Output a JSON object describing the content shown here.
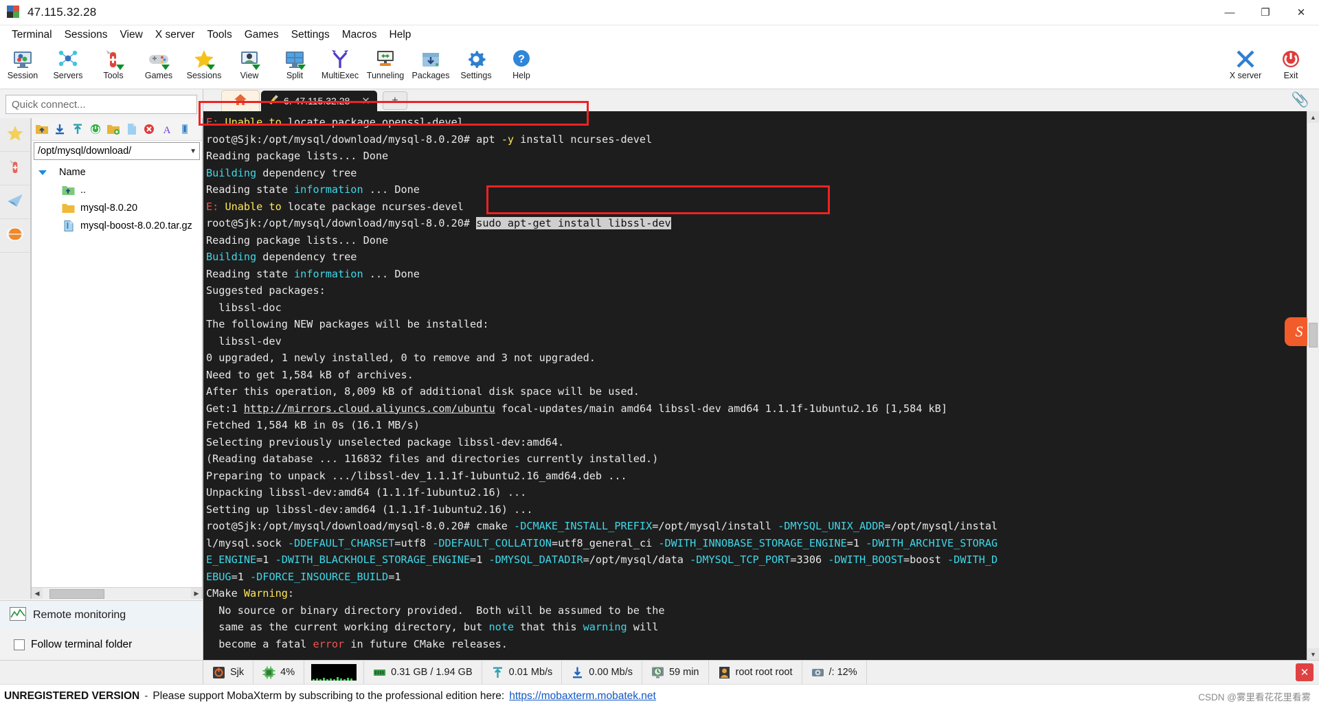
{
  "window": {
    "title": "47.115.32.28",
    "minimize": "—",
    "maximize": "❐",
    "close": "✕"
  },
  "menubar": {
    "items": [
      "Terminal",
      "Sessions",
      "View",
      "X server",
      "Tools",
      "Games",
      "Settings",
      "Macros",
      "Help"
    ]
  },
  "toolbar": {
    "buttons": [
      {
        "label": "Session",
        "icon": "session-icon"
      },
      {
        "label": "Servers",
        "icon": "servers-icon"
      },
      {
        "label": "Tools",
        "icon": "tools-icon"
      },
      {
        "label": "Games",
        "icon": "games-icon"
      },
      {
        "label": "Sessions",
        "icon": "sessions-star-icon"
      },
      {
        "label": "View",
        "icon": "view-icon"
      },
      {
        "label": "Split",
        "icon": "split-icon"
      },
      {
        "label": "MultiExec",
        "icon": "multiexec-icon"
      },
      {
        "label": "Tunneling",
        "icon": "tunneling-icon"
      },
      {
        "label": "Packages",
        "icon": "packages-icon"
      },
      {
        "label": "Settings",
        "icon": "settings-gear-icon"
      },
      {
        "label": "Help",
        "icon": "help-icon"
      }
    ],
    "right": [
      {
        "label": "X server",
        "icon": "xserver-icon"
      },
      {
        "label": "Exit",
        "icon": "exit-power-icon"
      }
    ]
  },
  "sidebar": {
    "quick_connect_placeholder": "Quick connect...",
    "vtabs": [
      {
        "name": "favorites-tab",
        "icon": "star-icon"
      },
      {
        "name": "tools-tab",
        "icon": "swiss-knife-icon"
      },
      {
        "name": "sessions-tab",
        "icon": "paper-plane-icon"
      },
      {
        "name": "macros-tab",
        "icon": "globe-icon"
      }
    ],
    "sftp_tools": [
      {
        "name": "parent-folder-button",
        "icon": "folder-up-icon"
      },
      {
        "name": "download-button",
        "icon": "download-arrow-icon"
      },
      {
        "name": "upload-button",
        "icon": "upload-arrow-icon"
      },
      {
        "name": "refresh-button",
        "icon": "refresh-circle-icon"
      },
      {
        "name": "new-folder-button",
        "icon": "new-folder-icon"
      },
      {
        "name": "new-file-button",
        "icon": "new-file-icon"
      },
      {
        "name": "delete-button",
        "icon": "delete-x-icon"
      },
      {
        "name": "text-mode-button",
        "icon": "letter-a-icon"
      },
      {
        "name": "binary-mode-button",
        "icon": "usb-drive-icon"
      }
    ],
    "path": "/opt/mysql/download/",
    "column_header": "Name",
    "files": [
      {
        "name": "..",
        "type": "parent-folder"
      },
      {
        "name": "mysql-8.0.20",
        "type": "folder"
      },
      {
        "name": "mysql-boost-8.0.20.tar.gz",
        "type": "file"
      }
    ],
    "remote_monitoring_label": "Remote monitoring",
    "follow_terminal_folder_label": "Follow terminal folder",
    "follow_checked": false
  },
  "tabs": {
    "home_icon": "home-icon",
    "terminal_tab": "6. 47.115.32.28",
    "terminal_tab_close": "✕",
    "new_tab": "+",
    "clip_icon": "paperclip-icon"
  },
  "terminal": {
    "lines": [
      [
        {
          "t": "E:",
          "c": "red"
        },
        {
          "t": " ",
          "c": "wht"
        },
        {
          "t": "Unable to",
          "c": "yel"
        },
        {
          "t": " locate package openssl-devel",
          "c": "wht"
        }
      ],
      [
        {
          "t": "root@Sjk:/opt/mysql/download/mysql-8.0.20# apt ",
          "c": "wht"
        },
        {
          "t": "-y",
          "c": "yel"
        },
        {
          "t": " install ncurses-devel",
          "c": "wht"
        }
      ],
      [
        {
          "t": "Reading package lists... Done",
          "c": "wht"
        }
      ],
      [
        {
          "t": "Building",
          "c": "cyan"
        },
        {
          "t": " dependency tree",
          "c": "wht"
        }
      ],
      [
        {
          "t": "Reading state ",
          "c": "wht"
        },
        {
          "t": "information",
          "c": "cyan"
        },
        {
          "t": " ... Done",
          "c": "wht"
        }
      ],
      [
        {
          "t": "E:",
          "c": "red"
        },
        {
          "t": " ",
          "c": "wht"
        },
        {
          "t": "Unable to",
          "c": "yel"
        },
        {
          "t": " locate package ncurses-devel",
          "c": "wht"
        }
      ],
      [
        {
          "t": "root@Sjk:/opt/mysql/download/mysql-8.0.20# ",
          "c": "wht"
        },
        {
          "t": "sudo apt-get install libssl-dev",
          "c": "sel"
        }
      ],
      [
        {
          "t": "Reading package lists... Done",
          "c": "wht"
        }
      ],
      [
        {
          "t": "Building",
          "c": "cyan"
        },
        {
          "t": " dependency tree",
          "c": "wht"
        }
      ],
      [
        {
          "t": "Reading state ",
          "c": "wht"
        },
        {
          "t": "information",
          "c": "cyan"
        },
        {
          "t": " ... Done",
          "c": "wht"
        }
      ],
      [
        {
          "t": "Suggested packages:",
          "c": "wht"
        }
      ],
      [
        {
          "t": "  libssl-doc",
          "c": "wht"
        }
      ],
      [
        {
          "t": "The following NEW packages will be installed:",
          "c": "wht"
        }
      ],
      [
        {
          "t": "  libssl-dev",
          "c": "wht"
        }
      ],
      [
        {
          "t": "0 upgraded, 1 newly installed, 0 to remove and 3 not upgraded.",
          "c": "wht"
        }
      ],
      [
        {
          "t": "Need to get 1,584 kB of archives.",
          "c": "wht"
        }
      ],
      [
        {
          "t": "After this operation, 8,009 kB of additional disk space will be used.",
          "c": "wht"
        }
      ],
      [
        {
          "t": "Get:1 ",
          "c": "wht"
        },
        {
          "t": "http://mirrors.cloud.aliyuncs.com/ubuntu",
          "c": "ul"
        },
        {
          "t": " focal-updates/main amd64 libssl-dev amd64 1.1.1f-1ubuntu2.16 [1,584 kB]",
          "c": "wht"
        }
      ],
      [
        {
          "t": "Fetched 1,584 kB in 0s (16.1 MB/s)",
          "c": "wht"
        }
      ],
      [
        {
          "t": "Selecting previously unselected package libssl-dev:amd64.",
          "c": "wht"
        }
      ],
      [
        {
          "t": "(Reading database ... 116832 files and directories currently installed.)",
          "c": "wht"
        }
      ],
      [
        {
          "t": "Preparing to unpack .../libssl-dev_1.1.1f-1ubuntu2.16_amd64.deb ...",
          "c": "wht"
        }
      ],
      [
        {
          "t": "Unpacking libssl-dev:amd64 (1.1.1f-1ubuntu2.16) ...",
          "c": "wht"
        }
      ],
      [
        {
          "t": "Setting up libssl-dev:amd64 (1.1.1f-1ubuntu2.16) ...",
          "c": "wht"
        }
      ],
      [
        {
          "t": "root@Sjk:/opt/mysql/download/mysql-8.0.20# cmake ",
          "c": "wht"
        },
        {
          "t": "-DCMAKE_INSTALL_PREFIX",
          "c": "cyan"
        },
        {
          "t": "=/opt/mysql/install ",
          "c": "wht"
        },
        {
          "t": "-DMYSQL_UNIX_ADDR",
          "c": "cyan"
        },
        {
          "t": "=/opt/mysql/instal",
          "c": "wht"
        }
      ],
      [
        {
          "t": "l/mysql.sock ",
          "c": "wht"
        },
        {
          "t": "-DDEFAULT_CHARSET",
          "c": "cyan"
        },
        {
          "t": "=utf8 ",
          "c": "wht"
        },
        {
          "t": "-DDEFAULT_COLLATION",
          "c": "cyan"
        },
        {
          "t": "=utf8_general_ci ",
          "c": "wht"
        },
        {
          "t": "-DWITH_INNOBASE_STORAGE_ENGINE",
          "c": "cyan"
        },
        {
          "t": "=1 ",
          "c": "wht"
        },
        {
          "t": "-DWITH_ARCHIVE_STORAG",
          "c": "cyan"
        }
      ],
      [
        {
          "t": "E_ENGINE",
          "c": "cyan"
        },
        {
          "t": "=1 ",
          "c": "wht"
        },
        {
          "t": "-DWITH_BLACKHOLE_STORAGE_ENGINE",
          "c": "cyan"
        },
        {
          "t": "=1 ",
          "c": "wht"
        },
        {
          "t": "-DMYSQL_DATADIR",
          "c": "cyan"
        },
        {
          "t": "=/opt/mysql/data ",
          "c": "wht"
        },
        {
          "t": "-DMYSQL_TCP_PORT",
          "c": "cyan"
        },
        {
          "t": "=3306 ",
          "c": "wht"
        },
        {
          "t": "-DWITH_BOOST",
          "c": "cyan"
        },
        {
          "t": "=boost ",
          "c": "wht"
        },
        {
          "t": "-DWITH_D",
          "c": "cyan"
        }
      ],
      [
        {
          "t": "EBUG",
          "c": "cyan"
        },
        {
          "t": "=1 ",
          "c": "wht"
        },
        {
          "t": "-DFORCE_INSOURCE_BUILD",
          "c": "cyan"
        },
        {
          "t": "=1",
          "c": "wht"
        }
      ],
      [
        {
          "t": "CMake ",
          "c": "wht"
        },
        {
          "t": "Warning",
          "c": "yel"
        },
        {
          "t": ":",
          "c": "wht"
        }
      ],
      [
        {
          "t": "  No source or binary directory provided.  Both will be assumed to be the",
          "c": "wht"
        }
      ],
      [
        {
          "t": "  same as the current working directory, but ",
          "c": "wht"
        },
        {
          "t": "note",
          "c": "cyan"
        },
        {
          "t": " that this ",
          "c": "wht"
        },
        {
          "t": "warning",
          "c": "cyan"
        },
        {
          "t": " will",
          "c": "wht"
        }
      ],
      [
        {
          "t": "  become a fatal ",
          "c": "wht"
        },
        {
          "t": "error",
          "c": "red"
        },
        {
          "t": " in future CMake releases.",
          "c": "wht"
        }
      ]
    ],
    "annotations": [
      {
        "name": "highlight-openssl-error"
      },
      {
        "name": "highlight-libssl-command"
      }
    ]
  },
  "statusbar": {
    "cells": [
      {
        "name": "hostname",
        "icon": "server-icon",
        "text": "Sjk"
      },
      {
        "name": "cpu-usage",
        "icon": "cpu-icon",
        "text": "4%"
      },
      {
        "name": "cpu-graph",
        "icon": "graph-icon",
        "text": ""
      },
      {
        "name": "memory",
        "icon": "memory-icon",
        "text": "0.31 GB / 1.94 GB"
      },
      {
        "name": "upload-speed",
        "icon": "upload-icon",
        "text": "0.01 Mb/s"
      },
      {
        "name": "download-speed",
        "icon": "download-icon",
        "text": "0.00 Mb/s"
      },
      {
        "name": "uptime",
        "icon": "clock-icon",
        "text": "59 min"
      },
      {
        "name": "users",
        "icon": "user-icon",
        "text": "root  root  root"
      },
      {
        "name": "disk-usage",
        "icon": "disk-icon",
        "text": "/: 12%"
      }
    ],
    "close_label": "✕"
  },
  "footer": {
    "unregistered": "UNREGISTERED VERSION",
    "dash": "-",
    "message": "Please support MobaXterm by subscribing to the professional edition here:",
    "link": "https://mobaxterm.mobatek.net",
    "watermark": "CSDN @雾里看花花里看雾"
  },
  "colors": {
    "accent": "#1257c4",
    "annotation": "#ee2222",
    "terminal_bg": "#1d1d1d",
    "error": "#ef5350",
    "warning": "#ffe657",
    "info": "#3fd7e8"
  }
}
